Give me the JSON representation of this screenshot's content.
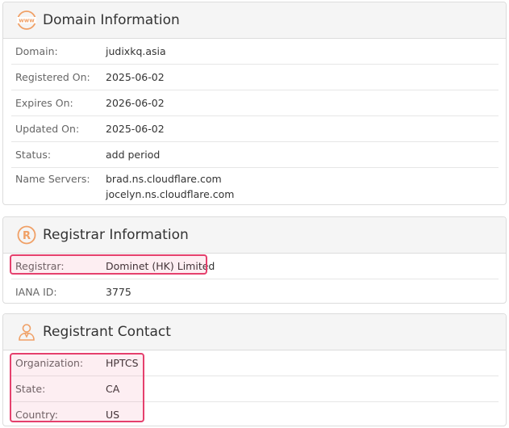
{
  "accent_color": "#f0a066",
  "highlight_color": "#e5406d",
  "domain_info": {
    "title": "Domain Information",
    "icon": "www-globe-icon",
    "rows": [
      {
        "label": "Domain:",
        "value": "judixkq.asia"
      },
      {
        "label": "Registered On:",
        "value": "2025-06-02"
      },
      {
        "label": "Expires On:",
        "value": "2026-06-02"
      },
      {
        "label": "Updated On:",
        "value": "2025-06-02"
      },
      {
        "label": "Status:",
        "value": "add period"
      }
    ],
    "name_servers": {
      "label": "Name Servers:",
      "values": [
        "brad.ns.cloudflare.com",
        "jocelyn.ns.cloudflare.com"
      ]
    }
  },
  "registrar_info": {
    "title": "Registrar Information",
    "icon": "registered-icon",
    "rows": [
      {
        "label": "Registrar:",
        "value": "Dominet (HK) Limited"
      },
      {
        "label": "IANA ID:",
        "value": "3775"
      }
    ]
  },
  "registrant_contact": {
    "title": "Registrant Contact",
    "icon": "person-icon",
    "rows": [
      {
        "label": "Organization:",
        "value": "HPTCS"
      },
      {
        "label": "State:",
        "value": "CA"
      },
      {
        "label": "Country:",
        "value": "US"
      }
    ]
  }
}
